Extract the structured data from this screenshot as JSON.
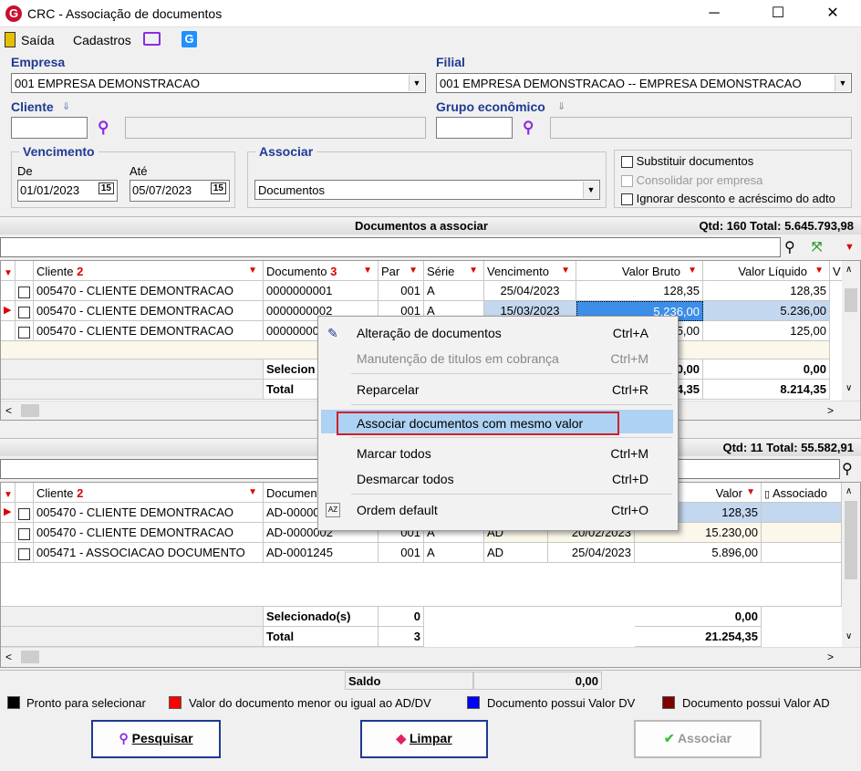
{
  "window": {
    "title": "CRC - Associação de documentos",
    "logo": "G",
    "minimize": "─",
    "maximize": "☐",
    "close": "✕"
  },
  "menubar": {
    "saida": "Saída",
    "cadastros": "Cadastros"
  },
  "empresa": {
    "label": "Empresa",
    "value": "001 EMPRESA DEMONSTRACAO"
  },
  "filial": {
    "label": "Filial",
    "value": "001 EMPRESA DEMONSTRACAO -- EMPRESA DEMONSTRACAO"
  },
  "cliente": {
    "label": "Cliente",
    "value": ""
  },
  "grupo": {
    "label": "Grupo econômico",
    "value": ""
  },
  "vencimento": {
    "label": "Vencimento",
    "de_label": "De",
    "ate_label": "Até",
    "de": "01/01/2023",
    "ate": "05/07/2023",
    "cal_icon": "15"
  },
  "associar": {
    "label": "Associar",
    "value": "Documentos"
  },
  "options": {
    "substituir": "Substituir documentos",
    "consolidar": "Consolidar por empresa",
    "ignorar": "Ignorar desconto e acréscimo do adto"
  },
  "top_section": {
    "title": "Documentos a associar",
    "summary": "Qtd: 160 Total: 5.645.793,98"
  },
  "top_grid": {
    "headers": [
      "Cliente",
      "Documento",
      "Par",
      "Série",
      "Vencimento",
      "Valor Bruto",
      "Valor Líquido",
      "V"
    ],
    "sort_cliente": "2",
    "sort_documento": "3",
    "rows": [
      [
        "005470 - CLIENTE DEMONTRACAO",
        "0000000001",
        "001",
        "A",
        "25/04/2023",
        "128,35",
        "128,35"
      ],
      [
        "005470 - CLIENTE DEMONTRACAO",
        "0000000002",
        "001",
        "A",
        "15/03/2023",
        "5.236,00",
        "5.236,00"
      ],
      [
        "005470 - CLIENTE DEMONTRACAO",
        "00000000",
        "001",
        "A",
        "",
        "5,00",
        "125,00"
      ]
    ],
    "selecionado_label": "Selecion",
    "selecionado_bruto": "0,00",
    "selecionado_liquido": "0,00",
    "total_label": "Total",
    "total_bruto": "4,35",
    "total_liquido": "8.214,35"
  },
  "bottom_section": {
    "summary": "Qtd: 11 Total: 55.582,91"
  },
  "bottom_grid": {
    "headers": [
      "Cliente",
      "Document",
      "Valor",
      "Associado"
    ],
    "sort_cliente": "2",
    "rows": [
      [
        "005470 - CLIENTE DEMONTRACAO",
        "AD-00000",
        "",
        "",
        "",
        "",
        "128,35"
      ],
      [
        "005470 - CLIENTE DEMONTRACAO",
        "AD-0000002",
        "001",
        "A",
        "AD",
        "20/02/2023",
        "15.230,00"
      ],
      [
        "005471 - ASSOCIACAO DOCUMENTO",
        "AD-0001245",
        "001",
        "A",
        "AD",
        "25/04/2023",
        "5.896,00"
      ]
    ],
    "selecionado_label": "Selecionado(s)",
    "selecionado_qtd": "0",
    "selecionado_valor": "0,00",
    "total_label": "Total",
    "total_qtd": "3",
    "total_valor": "21.254,35"
  },
  "saldo": {
    "label": "Saldo",
    "value": "0,00"
  },
  "legend": [
    {
      "color": "#000000",
      "text": "Pronto para selecionar"
    },
    {
      "color": "#ff0000",
      "text": "Valor do documento menor ou igual ao AD/DV"
    },
    {
      "color": "#0000ff",
      "text": "Documento possui Valor DV"
    },
    {
      "color": "#800000",
      "text": "Documento possui Valor AD"
    }
  ],
  "buttons": {
    "pesquisar": "Pesquisar",
    "limpar": "Limpar",
    "associar": "Associar"
  },
  "context_menu": [
    {
      "label": "Alteração de documentos",
      "shortcut": "Ctrl+A",
      "enabled": true
    },
    {
      "label": "Manutenção de titulos em cobrança",
      "shortcut": "Ctrl+M",
      "enabled": false
    },
    {
      "label": "Reparcelar",
      "shortcut": "Ctrl+R",
      "enabled": true
    },
    {
      "label": "Associar documentos com mesmo valor",
      "shortcut": "",
      "enabled": true
    },
    {
      "label": "Marcar todos",
      "shortcut": "Ctrl+M",
      "enabled": true
    },
    {
      "label": "Desmarcar todos",
      "shortcut": "Ctrl+D",
      "enabled": true
    },
    {
      "label": "Ordem default",
      "shortcut": "Ctrl+O",
      "enabled": true
    }
  ]
}
